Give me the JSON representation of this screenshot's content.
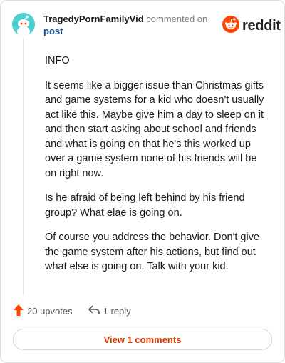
{
  "comment": {
    "username": "TragedyPornFamilyVid",
    "action_text": "commented on",
    "target_text": "post",
    "paragraphs": [
      "INFO",
      "It seems like a bigger issue than Christmas gifts and game systems for a kid who doesn't usually act like this. Maybe give him a day to sleep on it and then start asking about school and friends and what is going on that he's this worked up over a game system none of his friends will be on right now.",
      "Is he afraid of being left behind by his friend group? What elae is going on.",
      "Of course you address the behavior. Don't give the game system after his actions, but find out what else is going on. Talk with your kid."
    ],
    "upvotes_label": "20 upvotes",
    "replies_label": "1 reply"
  },
  "brand": {
    "name": "reddit",
    "color": "#ff4500"
  },
  "footer": {
    "view_comments_label": "View 1 comments"
  },
  "colors": {
    "accent": "#d93a00",
    "upvote": "#ff4500",
    "avatar": "#4dd0d0"
  },
  "icons": {
    "avatar": "snoo-avatar-icon",
    "logo": "reddit-logo-icon",
    "upvote": "upvote-arrow-icon",
    "reply": "reply-arrow-icon"
  }
}
